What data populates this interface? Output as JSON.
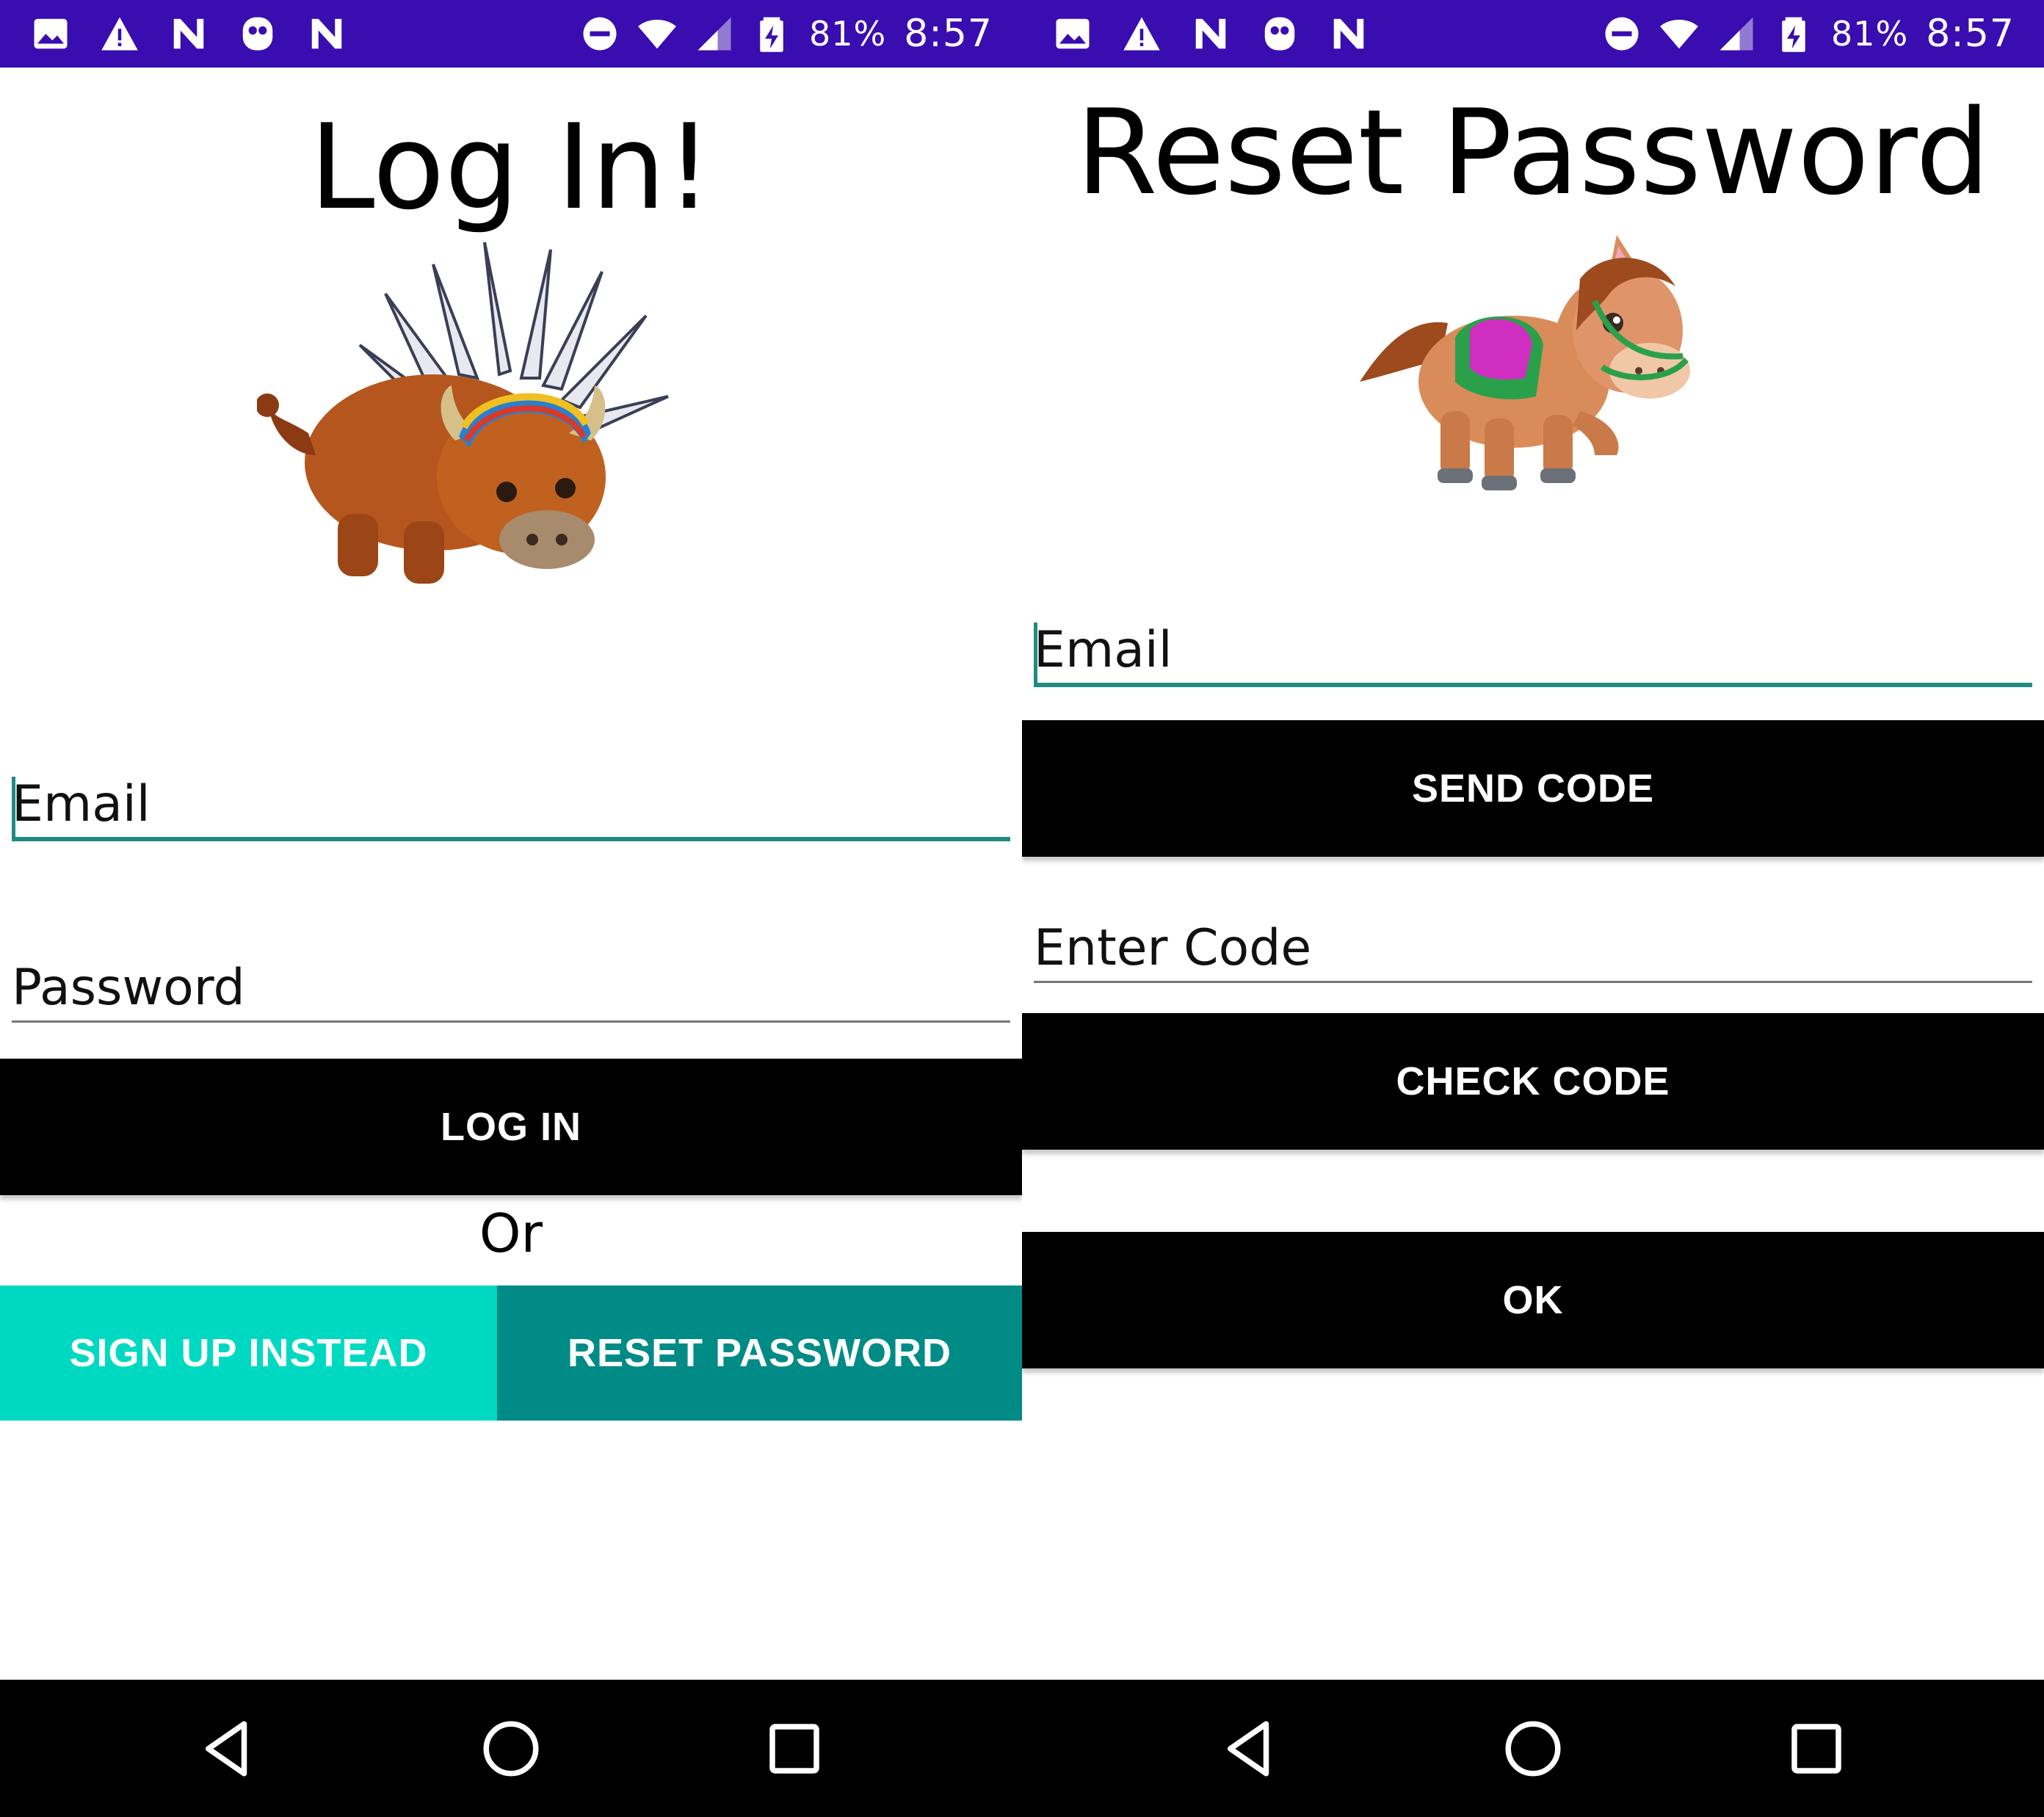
{
  "status_bar": {
    "battery_percent": "81%",
    "time": "8:57",
    "icons_left": [
      "image-icon",
      "warning-icon",
      "n-icon",
      "ghost-icon",
      "n-icon"
    ],
    "icons_right": [
      "do-not-disturb-icon",
      "wifi-icon",
      "cell-signal-icon",
      "battery-charging-icon"
    ],
    "background_color": "#3a0db0"
  },
  "login_screen": {
    "title": "Log In!",
    "mascot": "buffalo-with-headdress",
    "email_placeholder": "Email",
    "password_placeholder": "Password",
    "login_button": "LOG IN",
    "or_text": "Or",
    "signup_button": "SIGN UP INSTEAD",
    "reset_button": "RESET PASSWORD",
    "signup_color": "#00d9c2",
    "reset_color": "#008b87"
  },
  "reset_screen": {
    "title": "Reset Password",
    "mascot": "pony-with-saddle",
    "email_placeholder": "Email",
    "send_code_button": "SEND CODE",
    "code_placeholder": "Enter Code",
    "check_code_button": "CHECK CODE",
    "ok_button": "OK"
  },
  "nav_bar": {
    "buttons": [
      "back-icon",
      "home-icon",
      "recents-icon"
    ]
  },
  "accent_color": "#1e8c80"
}
